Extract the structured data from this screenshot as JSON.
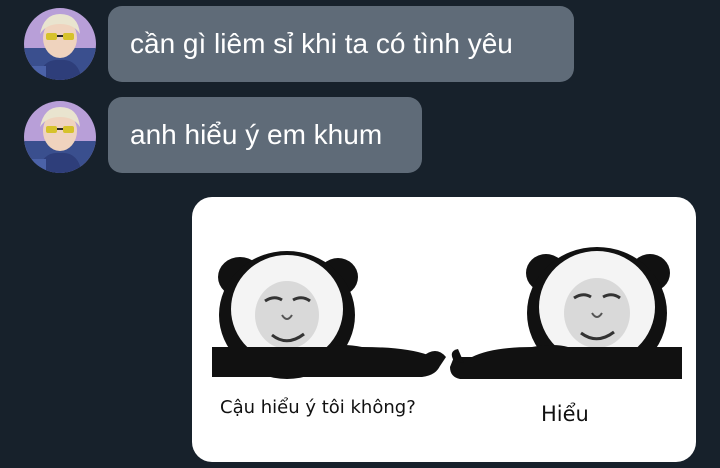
{
  "messages": [
    {
      "text": "cần gì liêm sỉ khi ta có tình yêu",
      "avatar": "user-avatar-photo"
    },
    {
      "text": "anh hiểu ý em khum",
      "avatar": "user-avatar-photo"
    }
  ],
  "sticker": {
    "caption_left": "Cậu hiểu ý tôi không?",
    "caption_right": "Hiểu"
  },
  "colors": {
    "background": "#17212b",
    "bubble": "#5f6b78",
    "text": "#ffffff"
  }
}
